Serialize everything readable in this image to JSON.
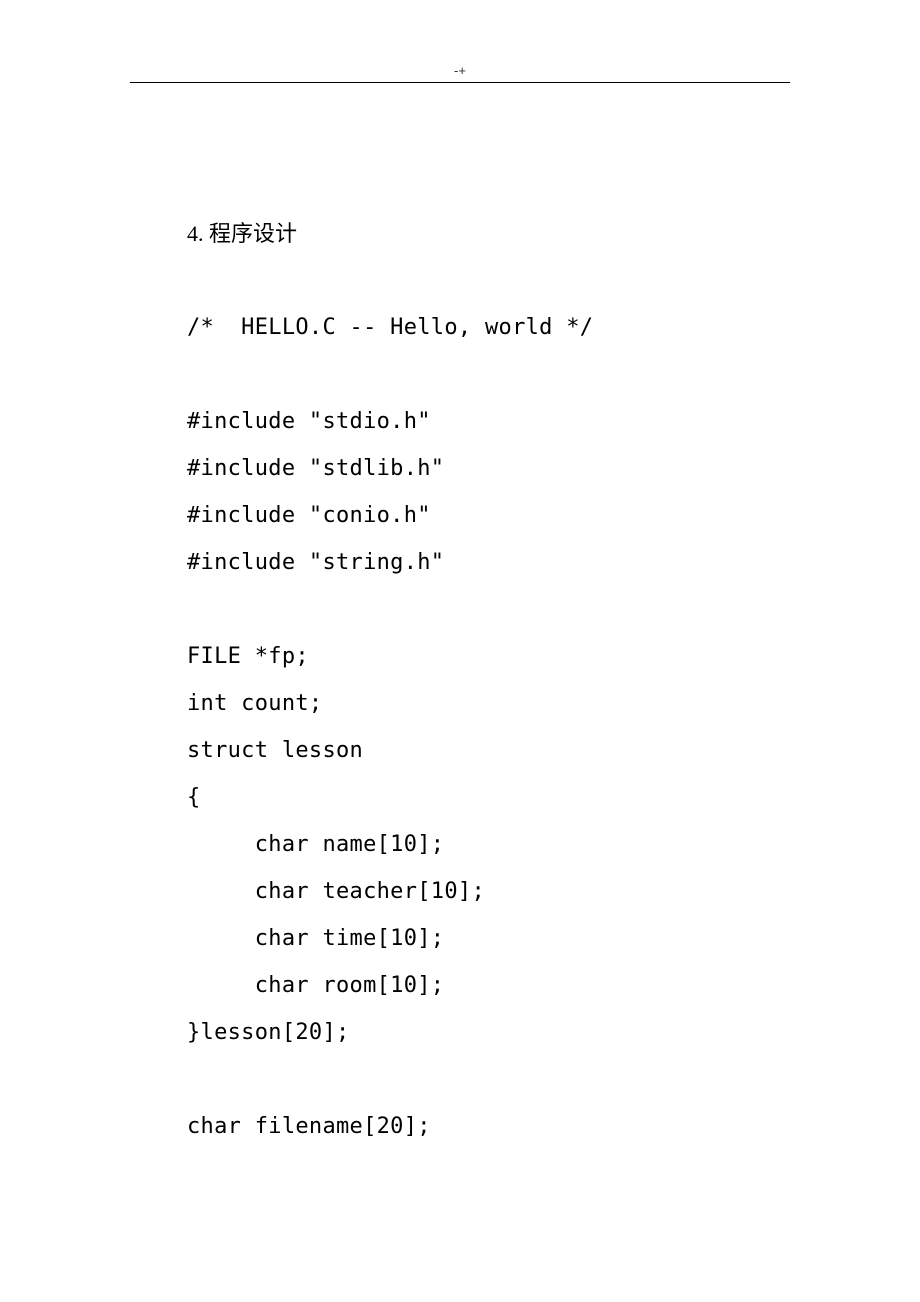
{
  "header": {
    "marker": "-+"
  },
  "section": {
    "heading": "4. 程序设计"
  },
  "code": {
    "lines": [
      "/*  HELLO.C -- Hello, world */",
      "",
      "#include \"stdio.h\"",
      "#include \"stdlib.h\"",
      "#include \"conio.h\"",
      "#include \"string.h\"",
      "",
      "FILE *fp;",
      "int count;",
      "struct lesson",
      "{",
      "     char name[10];",
      "     char teacher[10];",
      "     char time[10];",
      "     char room[10];",
      "}lesson[20];",
      "",
      "char filename[20];"
    ]
  }
}
